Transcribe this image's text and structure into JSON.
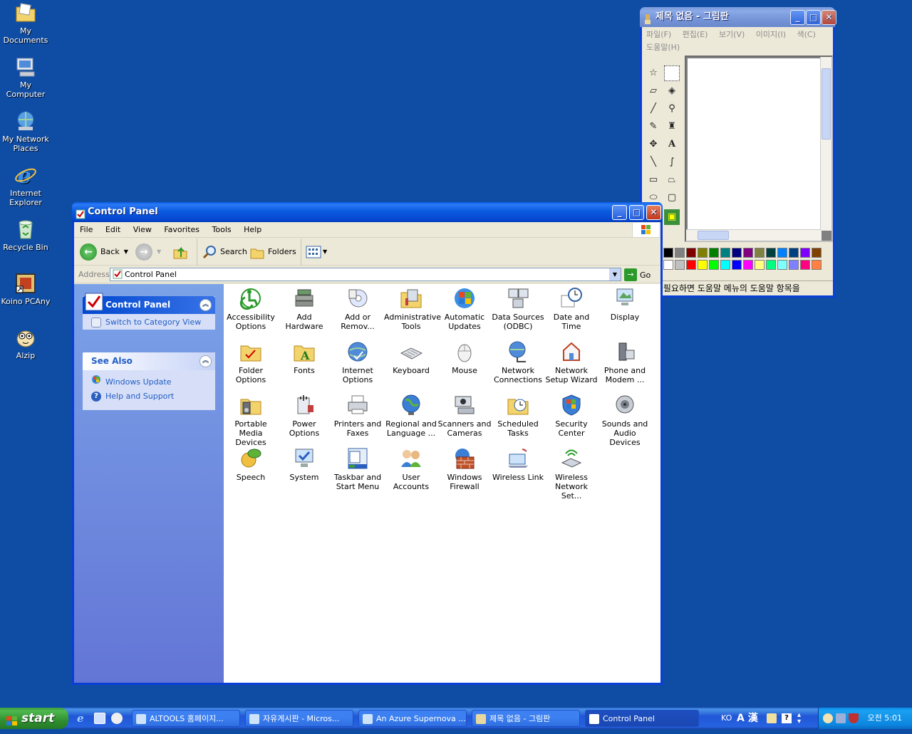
{
  "desktop": {
    "icons": [
      {
        "label": "My Documents"
      },
      {
        "label": "My Computer"
      },
      {
        "label": "My Network Places"
      },
      {
        "label": "Internet Explorer"
      },
      {
        "label": "Recycle Bin"
      },
      {
        "label": "Koino PCAny"
      },
      {
        "label": "Alzip"
      }
    ]
  },
  "paint": {
    "title": "제목 없음 - 그림판",
    "menu": [
      "파일(F)",
      "편집(E)",
      "보기(V)",
      "이미지(I)",
      "색(C)",
      "도움말(H)"
    ],
    "status": "말이 필요하면 도움말 메뉴의 도움말 항목을"
  },
  "control_panel": {
    "title": "Control Panel",
    "menu": [
      "File",
      "Edit",
      "View",
      "Favorites",
      "Tools",
      "Help"
    ],
    "toolbar": {
      "back": "Back",
      "search": "Search",
      "folders": "Folders"
    },
    "address_label": "Address",
    "address_value": "Control Panel",
    "go": "Go",
    "sidebar": {
      "panel_title": "Control Panel",
      "switch_view": "Switch to Category View",
      "see_also_title": "See Also",
      "see_also": [
        "Windows Update",
        "Help and Support"
      ]
    },
    "items": [
      "Accessibility Options",
      "Add Hardware",
      "Add or Remov...",
      "Administrative Tools",
      "Automatic Updates",
      "Data Sources (ODBC)",
      "Date and Time",
      "Display",
      "Folder Options",
      "Fonts",
      "Internet Options",
      "Keyboard",
      "Mouse",
      "Network Connections",
      "Network Setup Wizard",
      "Phone and Modem ...",
      "Portable Media Devices",
      "Power Options",
      "Printers and Faxes",
      "Regional and Language ...",
      "Scanners and Cameras",
      "Scheduled Tasks",
      "Security Center",
      "Sounds and Audio Devices",
      "Speech",
      "System",
      "Taskbar and Start Menu",
      "User Accounts",
      "Windows Firewall",
      "Wireless Link",
      "Wireless Network Set..."
    ]
  },
  "taskbar": {
    "start": "start",
    "tasks": [
      "ALTOOLS 홈페이지...",
      "자유게시판 - Micros...",
      "An Azure Supernova ...",
      "제목 없음 - 그림판",
      "Control Panel"
    ],
    "tray_lang": "KO",
    "tray_ime": "A 漢",
    "clock": "오전 5:01"
  },
  "colors": {
    "desktop": "#0f4da5",
    "titlebar": "#0b5be0",
    "link": "#215dc6"
  }
}
